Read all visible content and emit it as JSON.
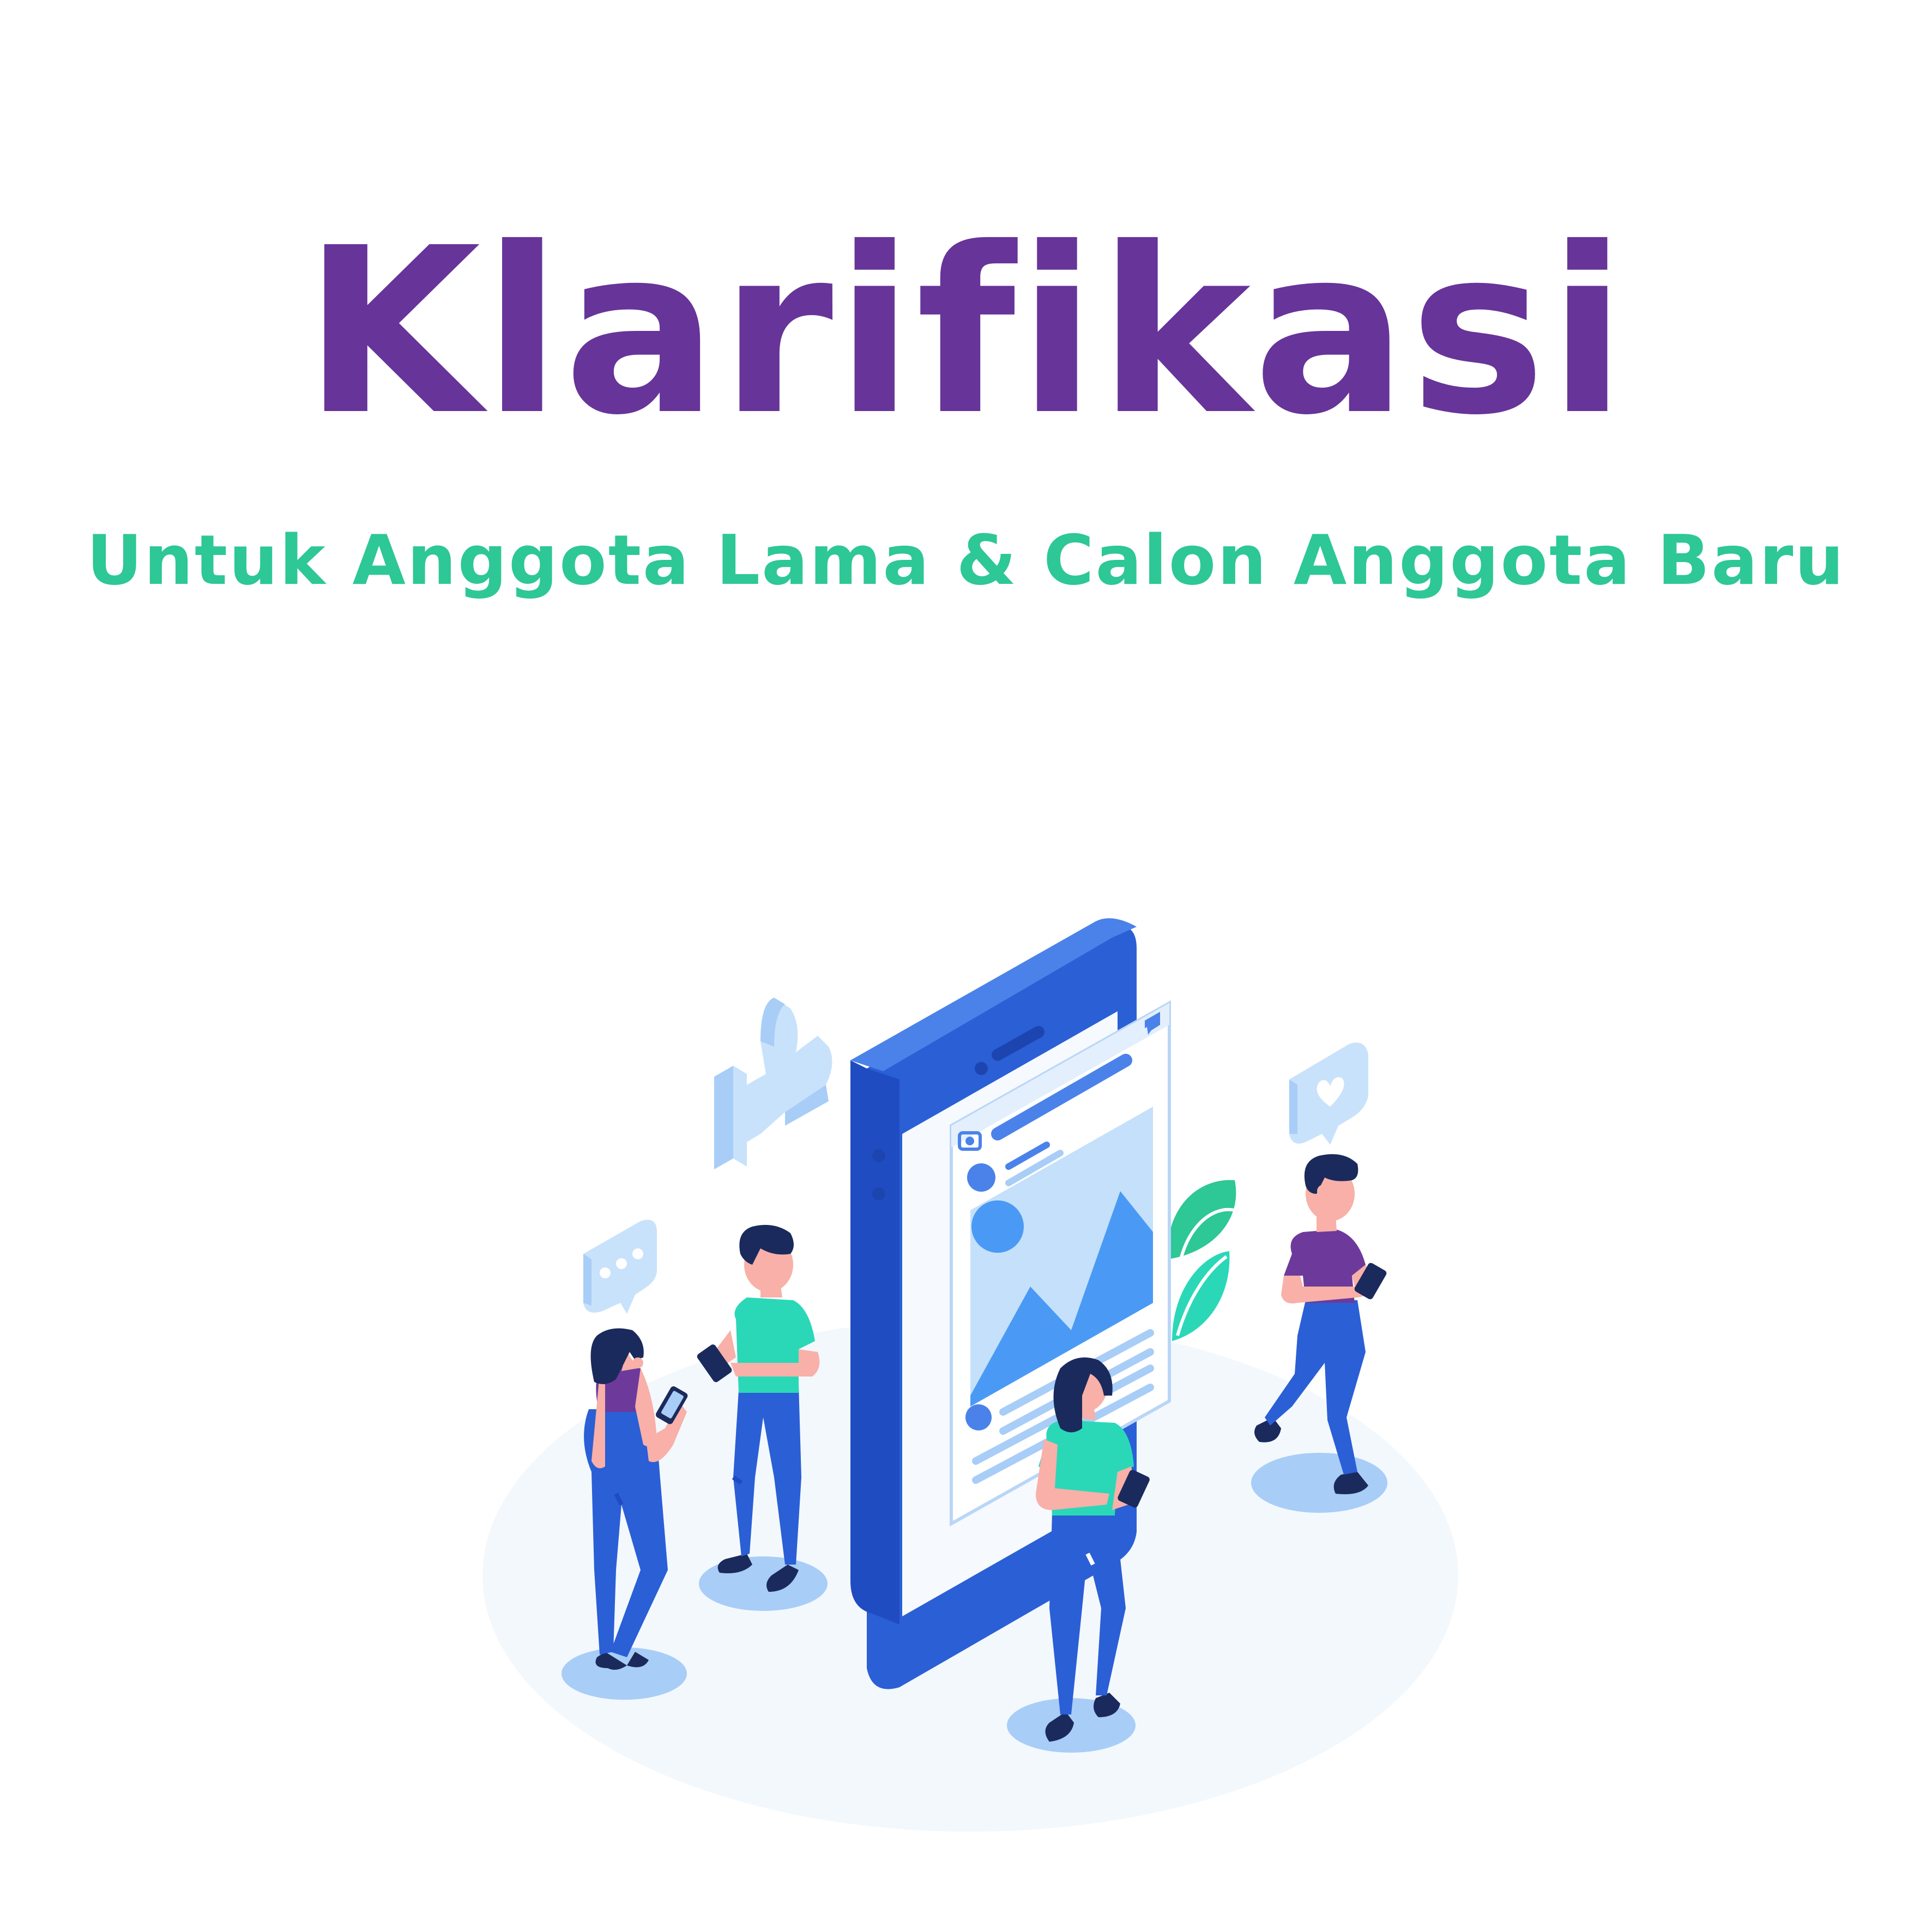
{
  "header": {
    "title": "Klarifikasi",
    "subtitle": "Untuk Anggota Lama & Calon Anggota Baru"
  },
  "colors": {
    "title": "#673499",
    "subtitle": "#2ec796",
    "phone": "#2d5fd6",
    "shirt_teal": "#2ad8b8",
    "shirt_purple": "#6d3a9b",
    "pants": "#2a5fd6"
  },
  "illustration": {
    "icons": [
      "thumbs-up-icon",
      "heart-chat-icon",
      "dots-chat-icon",
      "camera-icon",
      "image-icon",
      "chat-icon"
    ]
  }
}
